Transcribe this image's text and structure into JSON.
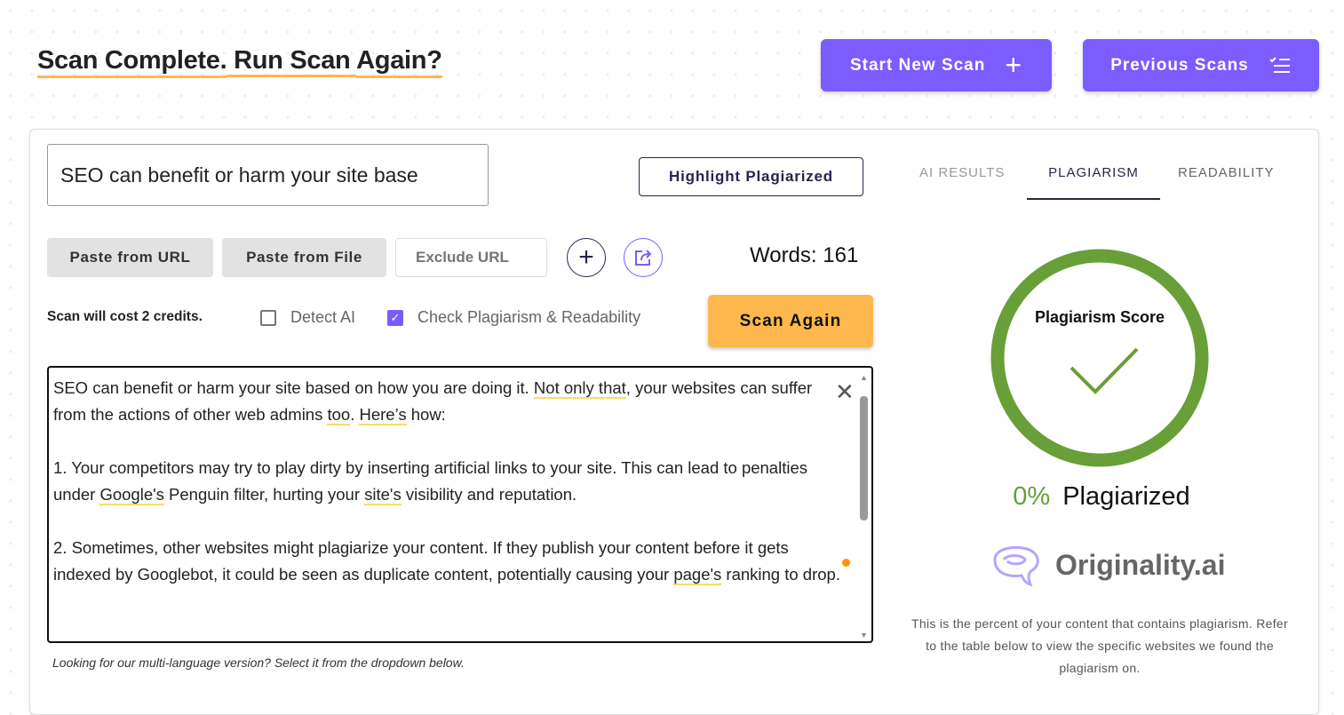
{
  "header": {
    "title_parts": [
      "Scan Complete.",
      " Run Scan ",
      "Again?"
    ],
    "start_new_scan": "Start New Scan",
    "previous_scans": "Previous Scans"
  },
  "editor": {
    "title_value": "SEO can benefit or harm your site base",
    "highlight_button": "Highlight Plagiarized",
    "paste_url": "Paste from URL",
    "paste_file": "Paste from File",
    "exclude_url_placeholder": "Exclude URL",
    "words": "Words: 161",
    "cost": "Scan will cost 2 credits.",
    "detect_ai": {
      "label": "Detect AI",
      "checked": false
    },
    "check_plagiarism": {
      "label": "Check Plagiarism & Readability",
      "checked": true
    },
    "scan_again": "Scan Again",
    "paragraphs": [
      [
        {
          "t": "SEO can benefit or harm your site based on how you are doing it. "
        },
        {
          "t": "Not only that",
          "u": true
        },
        {
          "t": ", your websites can suffer from the actions of other web admins "
        },
        {
          "t": "too",
          "u": true
        },
        {
          "t": ". "
        },
        {
          "t": "Here’s",
          "u": true
        },
        {
          "t": " how:"
        }
      ],
      [
        {
          "t": "1. Your competitors may try to play dirty by inserting artificial links to your site. This can lead to penalties under "
        },
        {
          "t": "Google's",
          "u": true
        },
        {
          "t": " Penguin filter, hurting your "
        },
        {
          "t": "site's",
          "u": true
        },
        {
          "t": " visibility and reputation."
        }
      ],
      [
        {
          "t": "2. Sometimes, other websites might plagiarize your content. If they publish your content before it gets indexed by Googlebot, it could be seen as duplicate content, potentially causing your "
        },
        {
          "t": "page's",
          "u": true
        },
        {
          "t": " ranking to drop."
        }
      ]
    ],
    "footer_note": "Looking for our multi-language version? Select it from the dropdown below."
  },
  "results": {
    "tabs": [
      {
        "label": "AI RESULTS",
        "active": false
      },
      {
        "label": "PLAGIARISM",
        "active": true
      },
      {
        "label": "READABILITY",
        "active": false
      }
    ],
    "score_label": "Plagiarism Score",
    "percent": "0%",
    "percent_value": 0,
    "percent_suffix": "Plagiarized",
    "logo_text": "Originality.ai",
    "description": "This is the percent of your content that contains plagiarism. Refer to the table below to view the specific websites we found the plagiarism on."
  },
  "colors": {
    "accent": "#7b5cff",
    "orange": "#ffb84d",
    "green": "#689f38"
  }
}
